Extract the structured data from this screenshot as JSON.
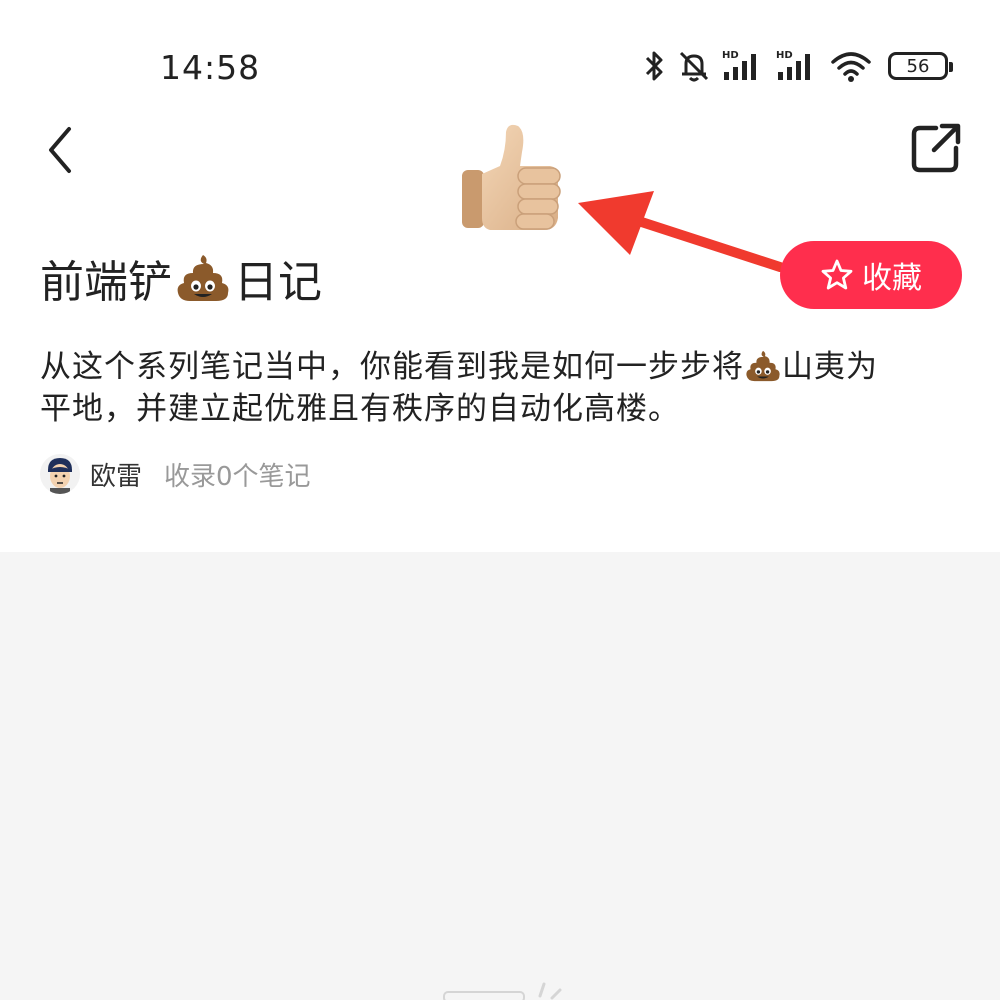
{
  "status_bar": {
    "time": "14:58",
    "battery": "56",
    "icons": [
      "bluetooth-icon",
      "mute-bell-icon",
      "signal-hd-icon",
      "signal-hd-icon",
      "wifi-icon",
      "battery-icon"
    ],
    "signal_label": "HD"
  },
  "nav": {
    "back_icon": "chevron-left-icon",
    "share_icon": "share-external-icon"
  },
  "decorations": {
    "thumb_icon": "thumbs-up-emoji",
    "arrow_icon": "red-arrow-pointer",
    "arrow_color": "#f03a2e"
  },
  "collection": {
    "title_before": "前端铲",
    "title_after": "日记",
    "favorite_label": "收藏",
    "accent_color": "#ff2e4d",
    "description_line1_before": "从这个系列笔记当中，你能看到我是如何一步步将",
    "description_line1_after": "山夷为",
    "description_line2": "平地，并建立起优雅且有秩序的自动化高楼。",
    "author_name": "欧雷",
    "note_count": "收录0个笔记"
  }
}
